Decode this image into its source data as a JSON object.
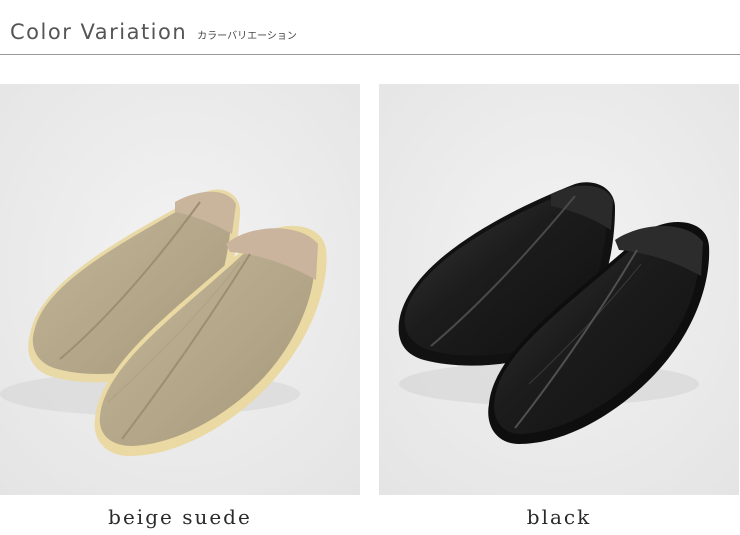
{
  "header": {
    "title": "Color Variation",
    "subtitle": "カラーバリエーション"
  },
  "variants": [
    {
      "caption": "beige suede",
      "color": "#b4a68a"
    },
    {
      "caption": "black",
      "color": "#1e1e1e"
    }
  ]
}
